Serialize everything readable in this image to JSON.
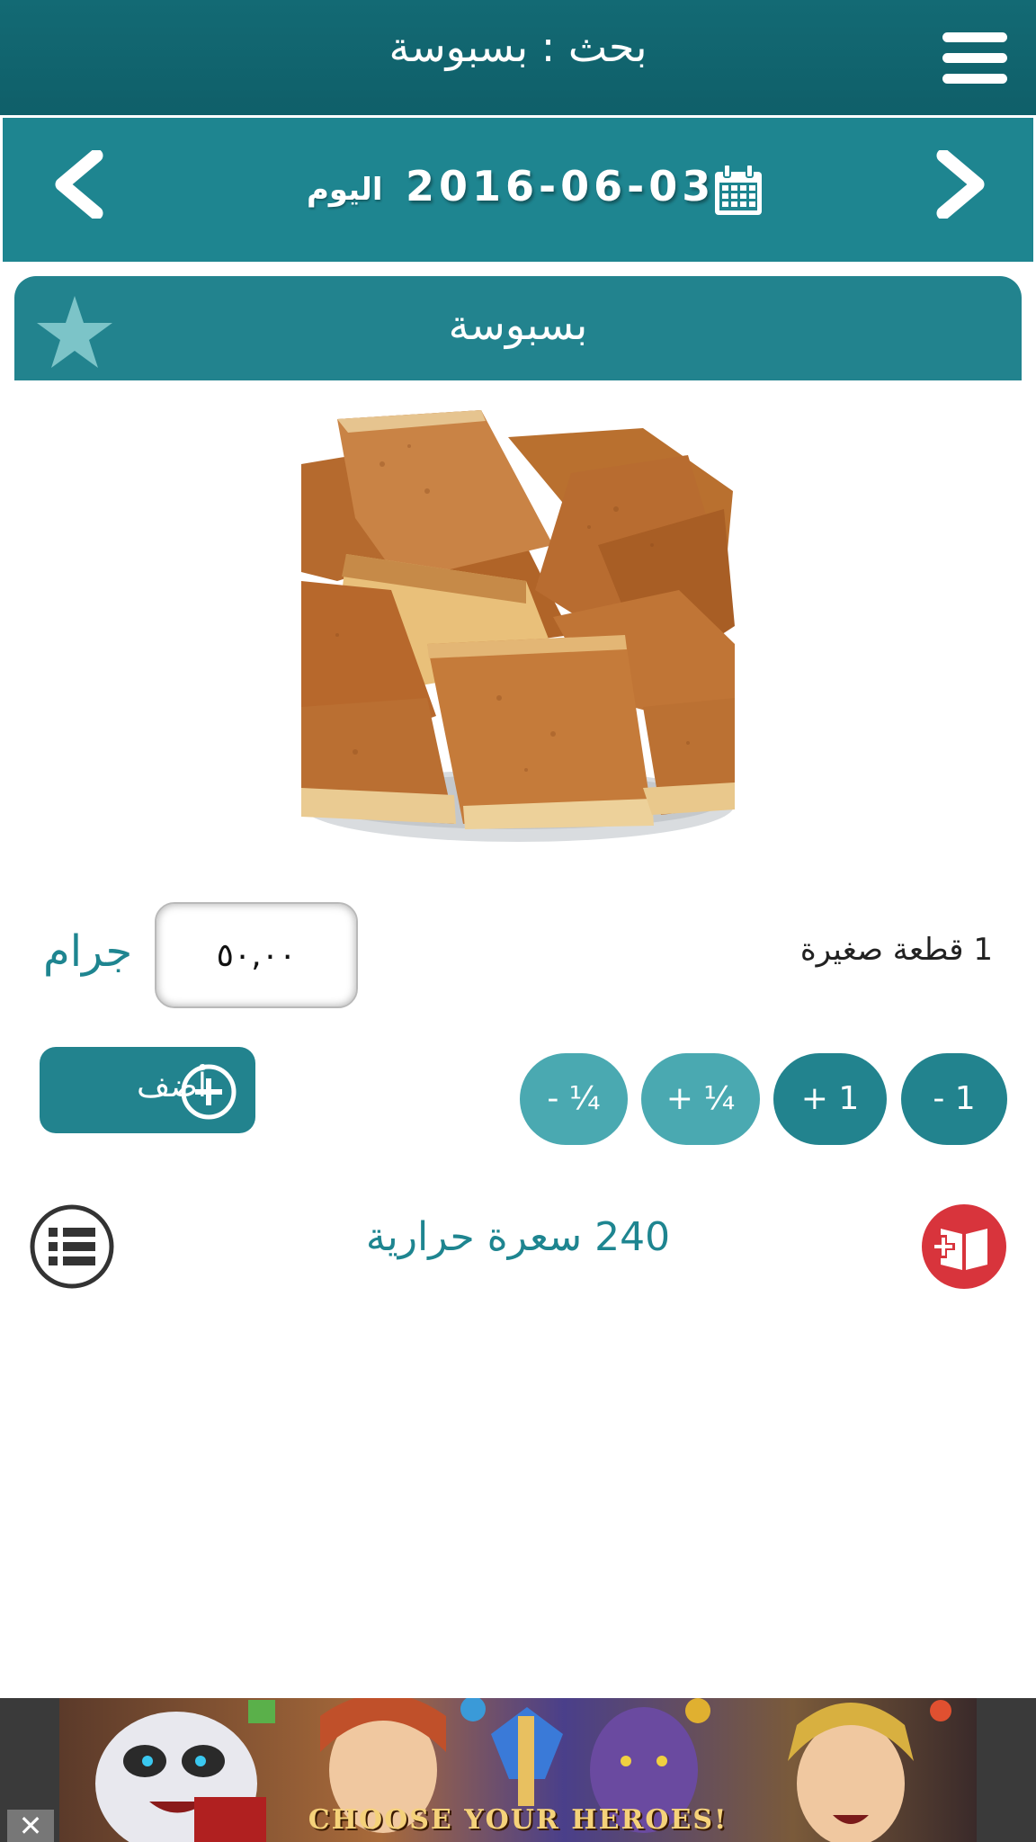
{
  "header": {
    "title": "بحث : بسبوسة",
    "menu_icon": "hamburger-menu-icon"
  },
  "date_bar": {
    "date": "2016-06-03",
    "today_label": "اليوم",
    "prev_icon": "chevron-left-icon",
    "next_icon": "chevron-right-icon",
    "calendar_icon": "calendar-icon"
  },
  "food": {
    "name": "بسبوسة",
    "favorite_icon": "star-icon",
    "photo_alt": "بسبوسة",
    "serving_label": "1 قطعة صغيرة",
    "quantity": "٥٠,٠٠",
    "unit": "جرام",
    "calories_text": "240 سعرة حرارية"
  },
  "actions": {
    "add_label": "أضف",
    "steps": [
      "- 1",
      "+ 1",
      "+ ¼",
      "- ¼"
    ]
  },
  "colors": {
    "header": "#136a74",
    "primary": "#22838e",
    "light_step": "#4aa9b1",
    "diary_red": "#d8343c"
  },
  "ad": {
    "text": "CHOOSE YOUR HEROES!",
    "close_label": "✕"
  }
}
